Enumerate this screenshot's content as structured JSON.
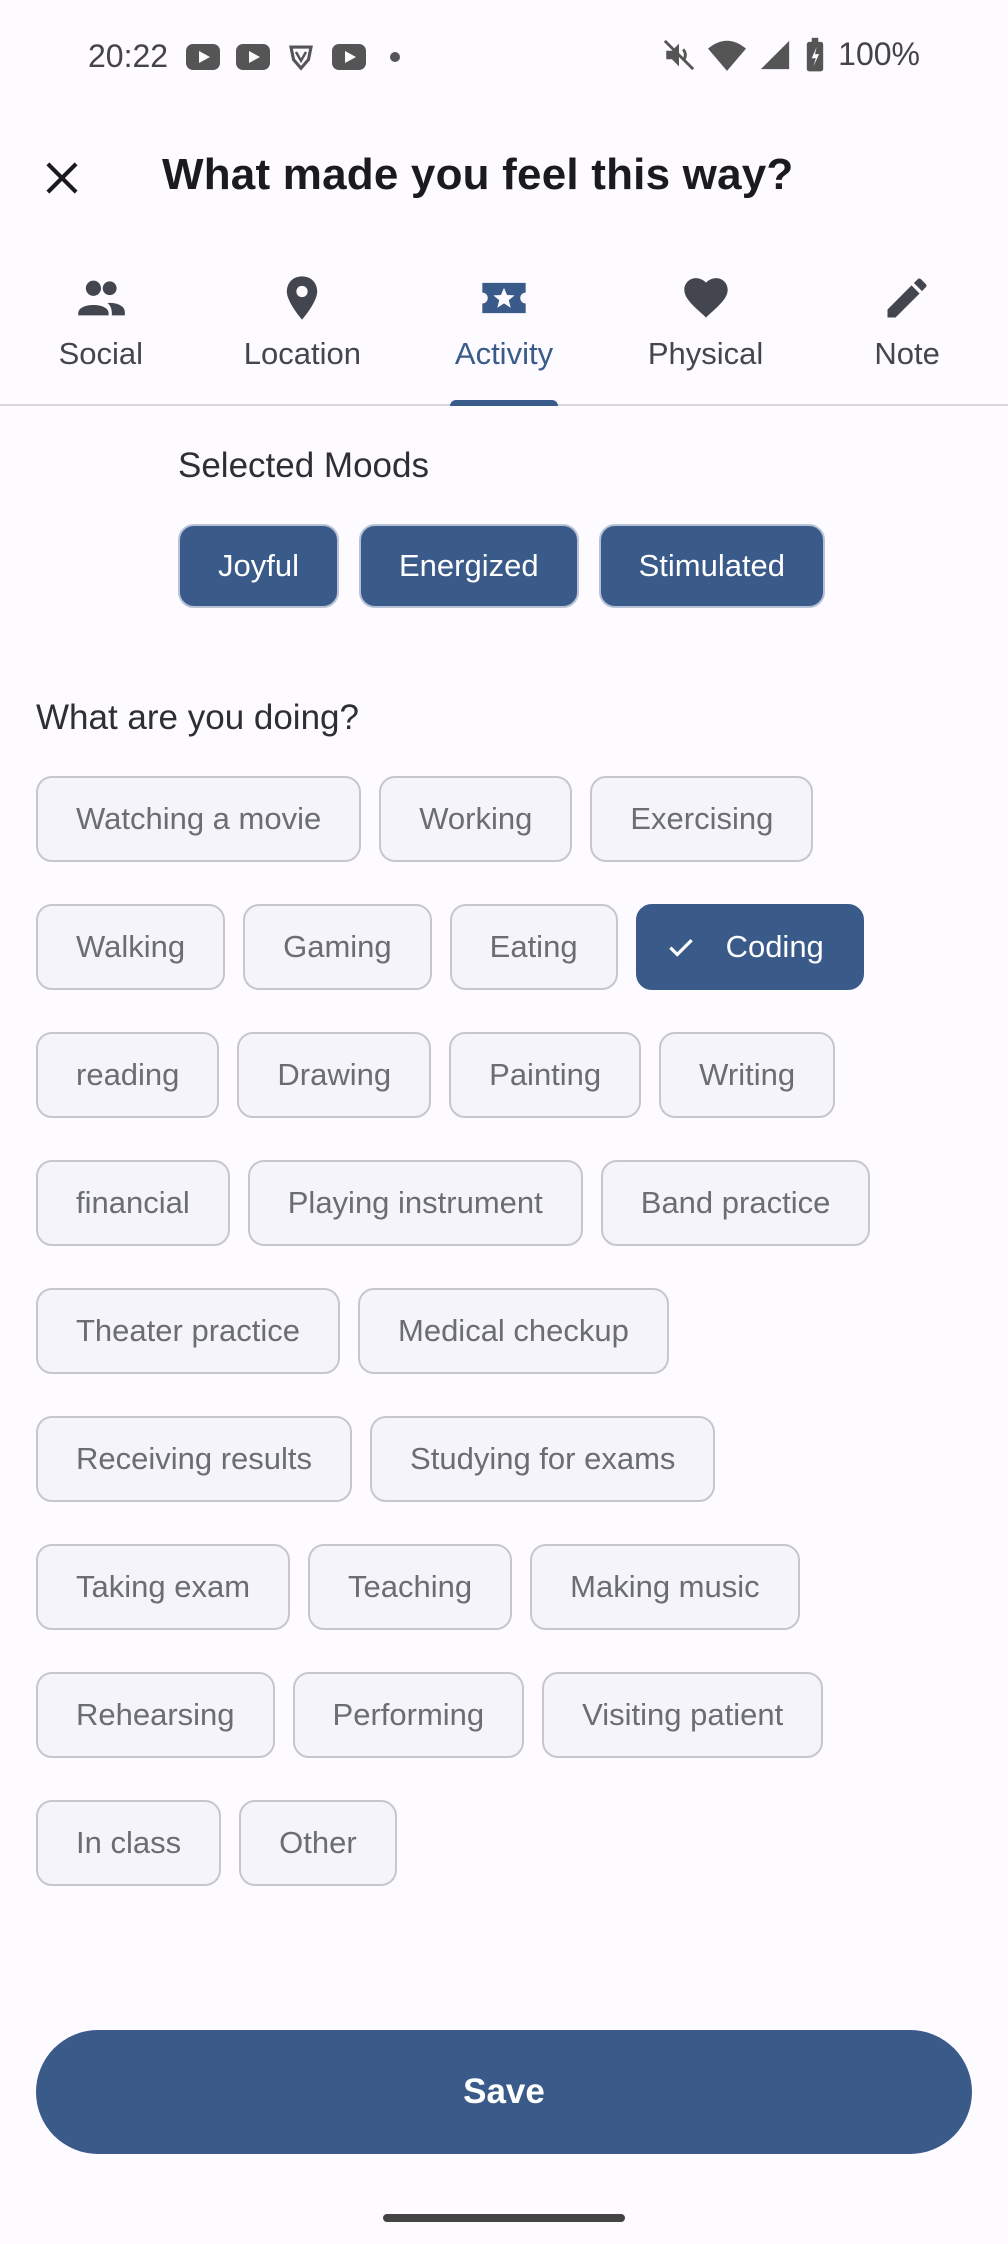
{
  "status_bar": {
    "time": "20:22",
    "battery": "100%",
    "icons": [
      "youtube-icon",
      "youtube-icon",
      "shield-icon",
      "youtube-icon",
      "dot-icon",
      "mute-icon",
      "wifi-icon",
      "signal-icon",
      "battery-icon"
    ]
  },
  "header": {
    "title": "What made you feel this way?",
    "close_icon": "close-icon"
  },
  "tabs": [
    {
      "label": "Social",
      "icon": "people-icon",
      "active": false
    },
    {
      "label": "Location",
      "icon": "location-pin-icon",
      "active": false
    },
    {
      "label": "Activity",
      "icon": "ticket-star-icon",
      "active": true
    },
    {
      "label": "Physical",
      "icon": "heart-icon",
      "active": false
    },
    {
      "label": "Note",
      "icon": "pencil-icon",
      "active": false
    }
  ],
  "selected_moods": {
    "title": "Selected Moods",
    "items": [
      "Joyful",
      "Energized",
      "Stimulated"
    ]
  },
  "activities": {
    "title": "What are you doing?",
    "rows": [
      [
        "Watching a movie",
        "Working",
        "Exercising"
      ],
      [
        "Walking",
        "Gaming",
        "Eating",
        "Coding"
      ],
      [
        "reading",
        "Drawing",
        "Painting",
        "Writing"
      ],
      [
        "financial",
        "Playing instrument",
        "Band practice"
      ],
      [
        "Theater practice",
        "Medical checkup"
      ],
      [
        "Receiving results",
        "Studying for exams"
      ],
      [
        "Taking exam",
        "Teaching",
        "Making music"
      ],
      [
        "Rehearsing",
        "Performing",
        "Visiting patient"
      ],
      [
        "In class",
        "Other"
      ]
    ],
    "selected": "Coding"
  },
  "save_label": "Save",
  "colors": {
    "primary": "#3a5a8a",
    "background": "#fdfbff",
    "chip_background": "#f4f4fa",
    "chip_border": "#c5c6d0"
  }
}
